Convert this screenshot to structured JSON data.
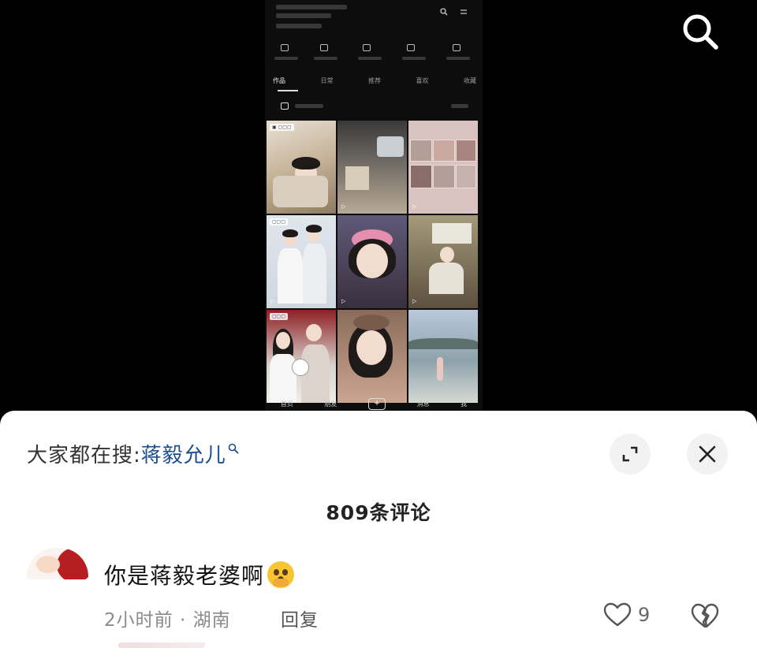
{
  "video": {
    "phone_tabs": [
      "作品",
      "日常",
      "推荐",
      "喜欢",
      "收藏"
    ],
    "phone_nav": [
      "首页",
      "朋友",
      "消息",
      "我"
    ],
    "plus_label": "+"
  },
  "sheet": {
    "hot_search_prefix": "大家都在搜:",
    "hot_search_term": "蒋毅允儿",
    "comment_count": "809条评论"
  },
  "comment": {
    "text": "你是蒋毅老婆啊",
    "meta": "2小时前 · 湖南",
    "reply_label": "回复",
    "like_count": "9"
  },
  "icons": {
    "search": "search-icon",
    "expand": "expand-icon",
    "close": "close-icon",
    "like": "heart-icon",
    "dislike": "broken-heart-icon"
  },
  "colors": {
    "hot_search_term": "#1b4d8f",
    "video_background": "#000000"
  }
}
